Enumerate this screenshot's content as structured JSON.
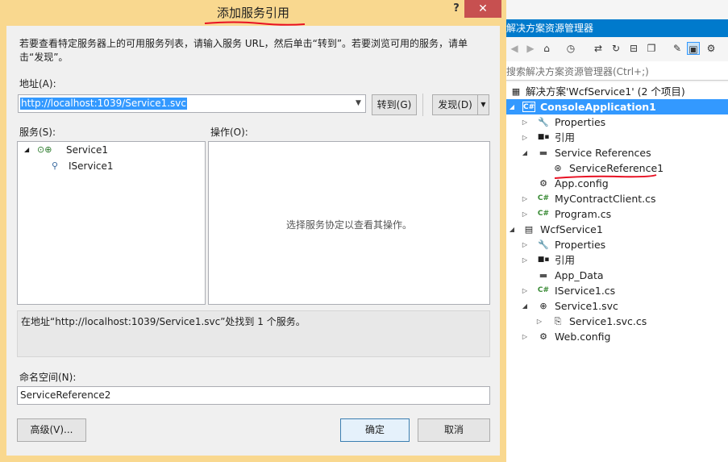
{
  "dialog": {
    "title": "添加服务引用",
    "help_glyph": "?",
    "close_glyph": "✕",
    "instruction": "若要查看特定服务器上的可用服务列表，请输入服务 URL，然后单击“转到”。若要浏览可用的服务，请单击“发现”。",
    "address_label": "地址(A):",
    "address_value": "http://localhost:1039/Service1.svc",
    "go_button": "转到(G)",
    "discover_button": "发现(D)",
    "services_label": "服务(S):",
    "operations_label": "操作(O):",
    "services_tree": [
      {
        "label": "Service1",
        "expanded": true,
        "icon": "service-globe-icon"
      },
      {
        "label": "IService1",
        "icon": "interface-contract-icon"
      }
    ],
    "operations_hint": "选择服务协定以查看其操作。",
    "status_message": "在地址“http://localhost:1039/Service1.svc”处找到 1 个服务。",
    "namespace_label": "命名空间(N):",
    "namespace_value": "ServiceReference2",
    "advanced_button": "高级(V)...",
    "ok_button": "确定",
    "cancel_button": "取消"
  },
  "solution_explorer": {
    "title": "解决方案资源管理器",
    "search_placeholder": "搜索解决方案资源管理器(Ctrl+;)",
    "toolbar_icons": [
      "back-icon",
      "forward-icon",
      "home-icon",
      "history-icon",
      "sync-icon",
      "refresh-icon",
      "collapse-icon",
      "copy-icon",
      "properties-icon",
      "show-all-icon",
      "preview-icon"
    ],
    "tree": [
      {
        "label": "解决方案'WcfService1' (2 个项目)",
        "icon": "solution-icon",
        "depth": 0,
        "expander": "none"
      },
      {
        "label": "ConsoleApplication1",
        "icon": "csharp-project-icon",
        "depth": 0,
        "expander": "expanded",
        "selected": true
      },
      {
        "label": "Properties",
        "icon": "wrench-icon",
        "depth": 1,
        "expander": "collapsed"
      },
      {
        "label": "引用",
        "icon": "references-icon",
        "depth": 1,
        "expander": "collapsed"
      },
      {
        "label": "Service References",
        "icon": "folder-icon",
        "depth": 1,
        "expander": "expanded"
      },
      {
        "label": "ServiceReference1",
        "icon": "service-reference-icon",
        "depth": 2,
        "expander": "none"
      },
      {
        "label": "App.config",
        "icon": "config-icon",
        "depth": 1,
        "expander": "none"
      },
      {
        "label": "MyContractClient.cs",
        "icon": "csharp-file-icon",
        "depth": 1,
        "expander": "collapsed"
      },
      {
        "label": "Program.cs",
        "icon": "csharp-file-icon",
        "depth": 1,
        "expander": "collapsed"
      },
      {
        "label": "WcfService1",
        "icon": "web-project-icon",
        "depth": 0,
        "expander": "expanded"
      },
      {
        "label": "Properties",
        "icon": "wrench-icon",
        "depth": 1,
        "expander": "collapsed"
      },
      {
        "label": "引用",
        "icon": "references-icon",
        "depth": 1,
        "expander": "collapsed"
      },
      {
        "label": "App_Data",
        "icon": "folder-icon",
        "depth": 1,
        "expander": "none"
      },
      {
        "label": "IService1.cs",
        "icon": "csharp-file-icon",
        "depth": 1,
        "expander": "collapsed"
      },
      {
        "label": "Service1.svc",
        "icon": "svc-icon",
        "depth": 1,
        "expander": "expanded"
      },
      {
        "label": "Service1.svc.cs",
        "icon": "csharp-file-icon",
        "depth": 2,
        "expander": "collapsed"
      },
      {
        "label": "Web.config",
        "icon": "config-icon",
        "depth": 1,
        "expander": "collapsed"
      }
    ]
  },
  "colors": {
    "dialog_border": "#f9d88f",
    "selection_blue": "#3399ff",
    "title_blue": "#007acc",
    "annotation_red": "#e81123"
  }
}
